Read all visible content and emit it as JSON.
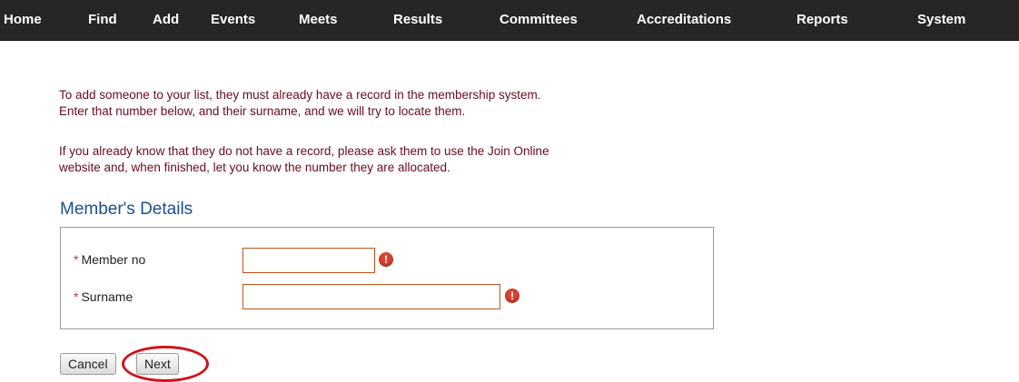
{
  "nav": {
    "items": [
      {
        "label": "Home"
      },
      {
        "label": "Find"
      },
      {
        "label": "Add"
      },
      {
        "label": "Events"
      },
      {
        "label": "Meets"
      },
      {
        "label": "Results"
      },
      {
        "label": "Committees"
      },
      {
        "label": "Accreditations"
      },
      {
        "label": "Reports"
      },
      {
        "label": "System"
      }
    ]
  },
  "intro": {
    "line1": "To add someone to your list, they must already have a record in the membership system.",
    "line2": "Enter that number below, and their surname, and we will try to locate them.",
    "line3": "If you already know that they do not have a record, please ask them to use the Join Online",
    "line4": "website and, when finished, let you know the number they are allocated."
  },
  "form": {
    "title": "Member's Details",
    "required_marker": "*",
    "member_no": {
      "label": "Member no",
      "value": ""
    },
    "surname": {
      "label": "Surname",
      "value": ""
    },
    "error_icon_glyph": "!"
  },
  "buttons": {
    "cancel": "Cancel",
    "next": "Next"
  },
  "colors": {
    "nav_bg": "#262626",
    "intro_text": "#6b0b1e",
    "title": "#1b4f8f",
    "error": "#d8432d",
    "highlight": "#d0121b"
  }
}
